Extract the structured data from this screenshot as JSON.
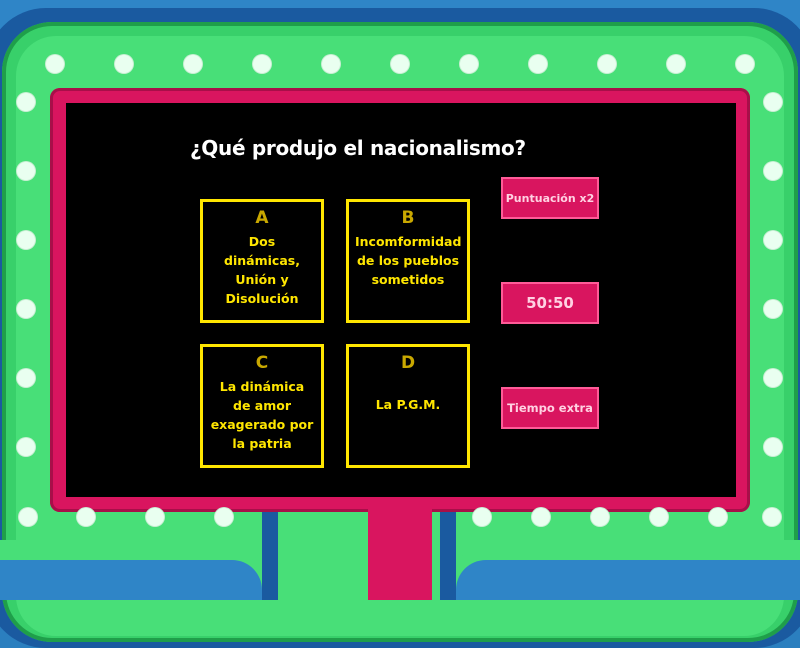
{
  "question": "¿Qué produjo el nacionalismo?",
  "answers": [
    {
      "letter": "A",
      "text": "Dos dinámicas, Unión y Disolución"
    },
    {
      "letter": "B",
      "text": "Incomformidad de los pueblos sometidos"
    },
    {
      "letter": "C",
      "text": "La dinámica de amor exagerado por la patria"
    },
    {
      "letter": "D",
      "text": "La P.G.M."
    }
  ],
  "powerups": {
    "double_score": "Puntuación x2",
    "fifty_fifty": "50:50",
    "extra_time": "Tiempo extra"
  },
  "colors": {
    "frame_green": "#48df78",
    "board_pink": "#d9155f",
    "answer_yellow": "#ffe600",
    "background_blue": "#2f85c7"
  }
}
